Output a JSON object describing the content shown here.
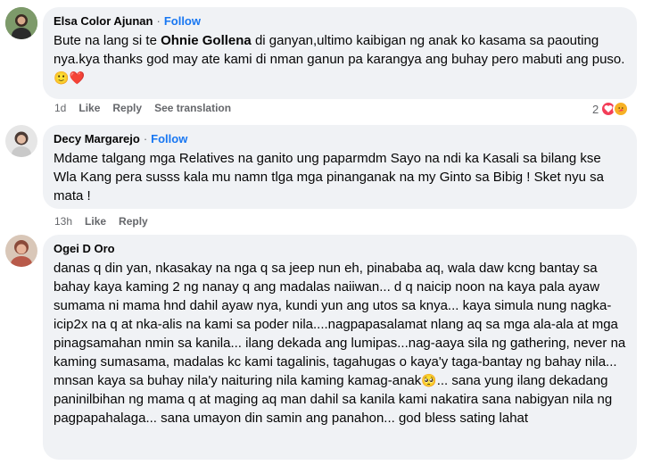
{
  "comments": [
    {
      "name": "Elsa Color Ajunan",
      "follow": "Follow",
      "text_pre": "Bute na lang si te ",
      "mention": "Ohnie Gollena",
      "text_post": " di ganyan,ultimo kaibigan ng anak ko kasama sa paouting nya.kya thanks god may ate kami di nman ganun pa karangya ang buhay pero mabuti ang puso.",
      "emojis": [
        "🙂",
        "❤️"
      ],
      "time": "1d",
      "like": "Like",
      "reply": "Reply",
      "see_translation": "See translation",
      "reaction_count": "2",
      "reaction_icons": [
        "love-icon",
        "care-icon"
      ]
    },
    {
      "name": "Decy Margarejo",
      "follow": "Follow",
      "text": "Mdame talgang mga Relatives na ganito ung paparmdm Sayo na ndi ka Kasali sa bilang kse Wla Kang pera susss kala mu namn tlga mga pinanganak na my Ginto sa Bibig ! Sket nyu sa mata !",
      "time": "13h",
      "like": "Like",
      "reply": "Reply"
    },
    {
      "name": "Ogei D Oro",
      "text_main": "danas q din yan, nkasakay na nga q sa jeep nun eh, pinababa aq, wala daw kcng bantay sa bahay kaya kaming 2 ng nanay q ang madalas naiiwan... d q naicip noon na kaya pala ayaw sumama ni mama hnd dahil ayaw nya, kundi yun ang utos sa knya... kaya simula nung nagka-icip2x na q at nka-alis na kami sa poder nila....nagpapasalamat nlang aq sa mga ala-ala at mga pinagsamahan nmin sa kanila... ilang dekada ang lumipas...nag-aaya sila ng gathering, never na kaming sumasama, madalas kc kami tagalinis, tagahugas o kaya'y taga-bantay ng bahay nila... mnsan kaya sa buhay nila'y naituring nila kaming kamag-anak",
      "emoji": "🥺",
      "text_end": "... sana yung ilang dekadang paninilbihan ng mama q at maging aq man dahil sa kanila kami nakatira sana nabigyan nila ng pagpapahalaga... sana umayon din samin ang panahon... god bless sating lahat"
    }
  ],
  "colors": {
    "bubble": "#f0f2f5",
    "link": "#1877f2",
    "meta": "#65676b",
    "text": "#050505"
  }
}
